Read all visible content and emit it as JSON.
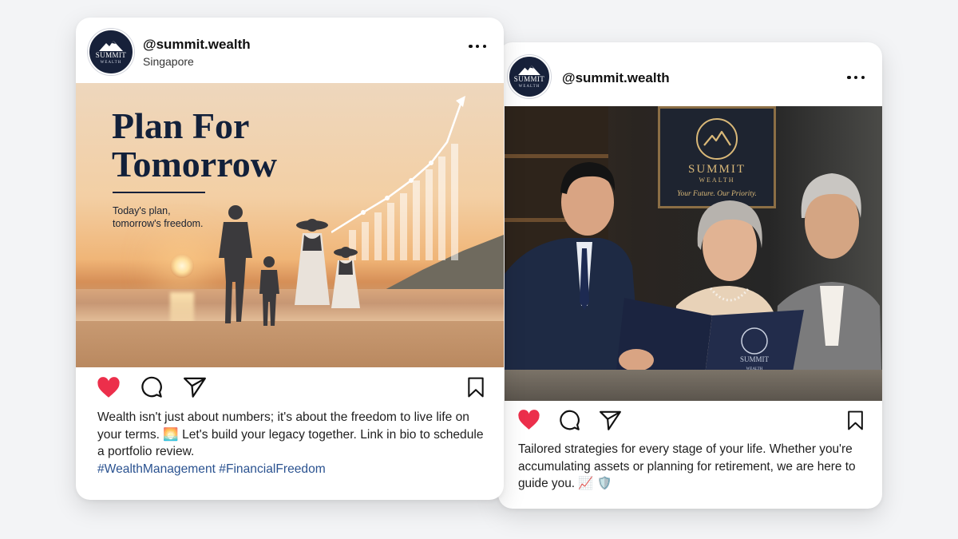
{
  "post_left": {
    "account": {
      "handle": "@summit.wealth",
      "location": "Singapore",
      "avatar_logo_text": "SUMMIT",
      "avatar_logo_subtext": "WEALTH"
    },
    "image": {
      "headline_line1": "Plan For",
      "headline_line2": "Tomorrow",
      "tagline_line1": "Today's plan,",
      "tagline_line2": "tomorrow's freedom."
    },
    "actions": {
      "like_icon": "heart-filled-icon",
      "comment_icon": "comment-icon",
      "share_icon": "send-icon",
      "save_icon": "bookmark-icon"
    },
    "caption": {
      "text": "Wealth isn't just about numbers; it's about the freedom to live life on your terms. 🌅 Let's build your legacy together. Link in bio to schedule a portfolio review.",
      "hashtags": "#WealthManagement #FinancialFreedom"
    }
  },
  "post_right": {
    "account": {
      "handle": "@summit.wealth",
      "avatar_logo_text": "SUMMIT",
      "avatar_logo_subtext": "WEALTH"
    },
    "image": {
      "plaque_title": "SUMMIT",
      "plaque_subtitle": "WEALTH",
      "plaque_tagline": "Your Future. Our Priority.",
      "folder_title": "SUMMIT",
      "folder_subtitle": "WEALTH"
    },
    "actions": {
      "like_icon": "heart-filled-icon",
      "comment_icon": "comment-icon",
      "share_icon": "send-icon",
      "save_icon": "bookmark-icon"
    },
    "caption": {
      "text": "Tailored strategies for every stage of your life. Whether you're accumulating assets or planning for retirement, we are here to guide you. 📈 🛡️"
    }
  },
  "colors": {
    "like_red": "#ec2f4b",
    "navy": "#12203a",
    "hashtag_blue": "#2a5290",
    "gold": "#d9b878"
  }
}
